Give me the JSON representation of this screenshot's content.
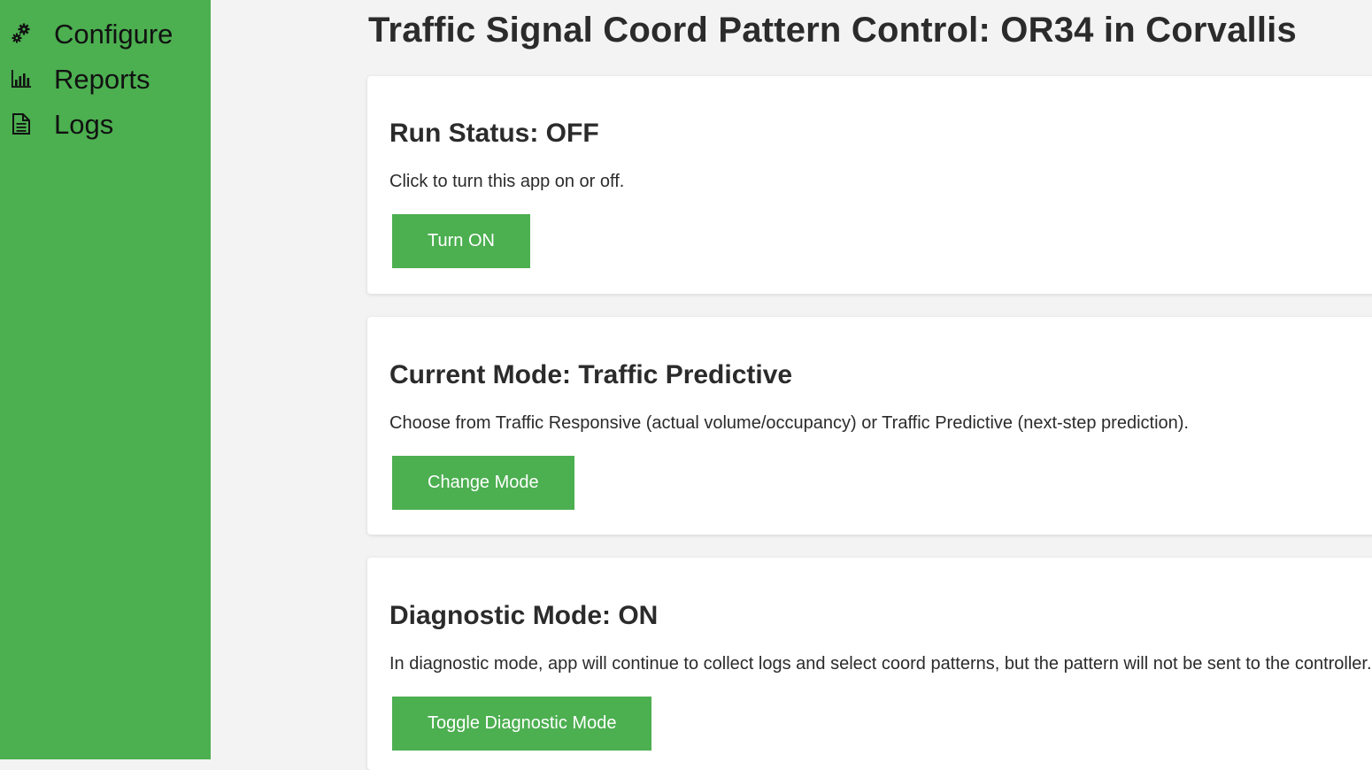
{
  "sidebar": {
    "items": [
      {
        "label": "Configure",
        "icon": "gears-icon"
      },
      {
        "label": "Reports",
        "icon": "bar-chart-icon"
      },
      {
        "label": "Logs",
        "icon": "document-icon"
      }
    ],
    "color": "#4caf50"
  },
  "page": {
    "title": "Traffic Signal Coord Pattern Control: OR34 in Corvallis"
  },
  "cards": {
    "run_status": {
      "heading": "Run Status: OFF",
      "description": "Click to turn this app on or off.",
      "button_label": "Turn ON"
    },
    "current_mode": {
      "heading": "Current Mode: Traffic Predictive",
      "description": "Choose from Traffic Responsive (actual volume/occupancy) or Traffic Predictive (next-step prediction).",
      "button_label": "Change Mode"
    },
    "diagnostic_mode": {
      "heading": "Diagnostic Mode: ON",
      "description": "In diagnostic mode, app will continue to collect logs and select coord patterns, but the pattern will not be sent to the controller.",
      "button_label": "Toggle Diagnostic Mode"
    }
  },
  "colors": {
    "accent": "#4caf50",
    "background": "#f3f3f3",
    "card": "#ffffff"
  }
}
